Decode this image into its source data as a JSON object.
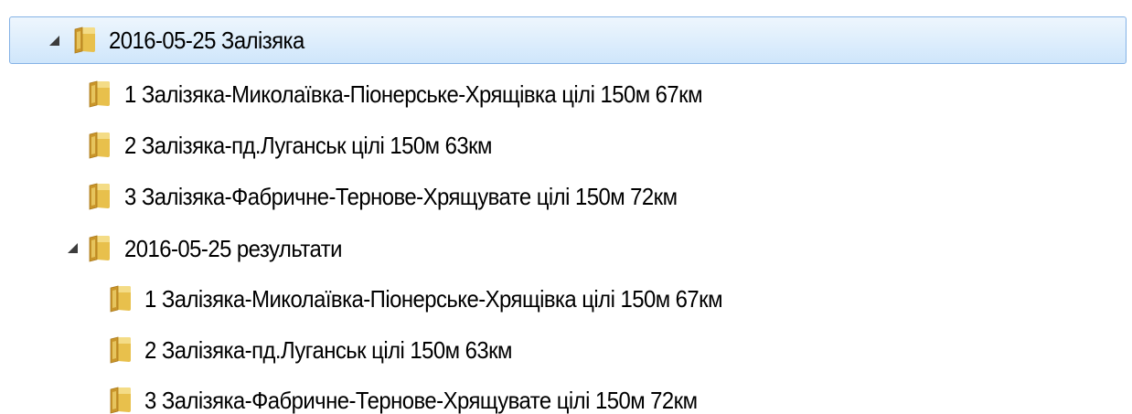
{
  "tree": {
    "items": [
      {
        "label": "2016-05-25 Залізяка",
        "level": 0,
        "expanded": true,
        "selected": true,
        "icon": "folder-icon"
      },
      {
        "label": "1 Залізяка-Миколаївка-Піонерське-Хрящівка цілі 150м 67км",
        "level": 1,
        "expanded": false,
        "selected": false,
        "icon": "folder-icon"
      },
      {
        "label": "2 Залізяка-пд.Луганськ цілі 150м 63км",
        "level": 1,
        "expanded": false,
        "selected": false,
        "icon": "folder-icon"
      },
      {
        "label": "3 Залізяка-Фабричне-Тернове-Хрящувате цілі 150м 72км",
        "level": 1,
        "expanded": false,
        "selected": false,
        "icon": "folder-icon"
      },
      {
        "label": "2016-05-25 результати",
        "level": 1,
        "expanded": true,
        "selected": false,
        "icon": "folder-icon"
      },
      {
        "label": "1 Залізяка-Миколаївка-Піонерське-Хрящівка цілі 150м 67км",
        "level": 2,
        "expanded": false,
        "selected": false,
        "icon": "folder-icon"
      },
      {
        "label": "2 Залізяка-пд.Луганськ цілі 150м 63км",
        "level": 2,
        "expanded": false,
        "selected": false,
        "icon": "folder-icon"
      },
      {
        "label": "3 Залізяка-Фабричне-Тернове-Хрящувате цілі 150м 72км",
        "level": 2,
        "expanded": false,
        "selected": false,
        "icon": "folder-icon"
      }
    ],
    "colors": {
      "selection_top": "#eef6fd",
      "selection_bottom": "#cfe6fb",
      "selection_border": "#84b2e6",
      "folder": "#e8c04c"
    }
  }
}
